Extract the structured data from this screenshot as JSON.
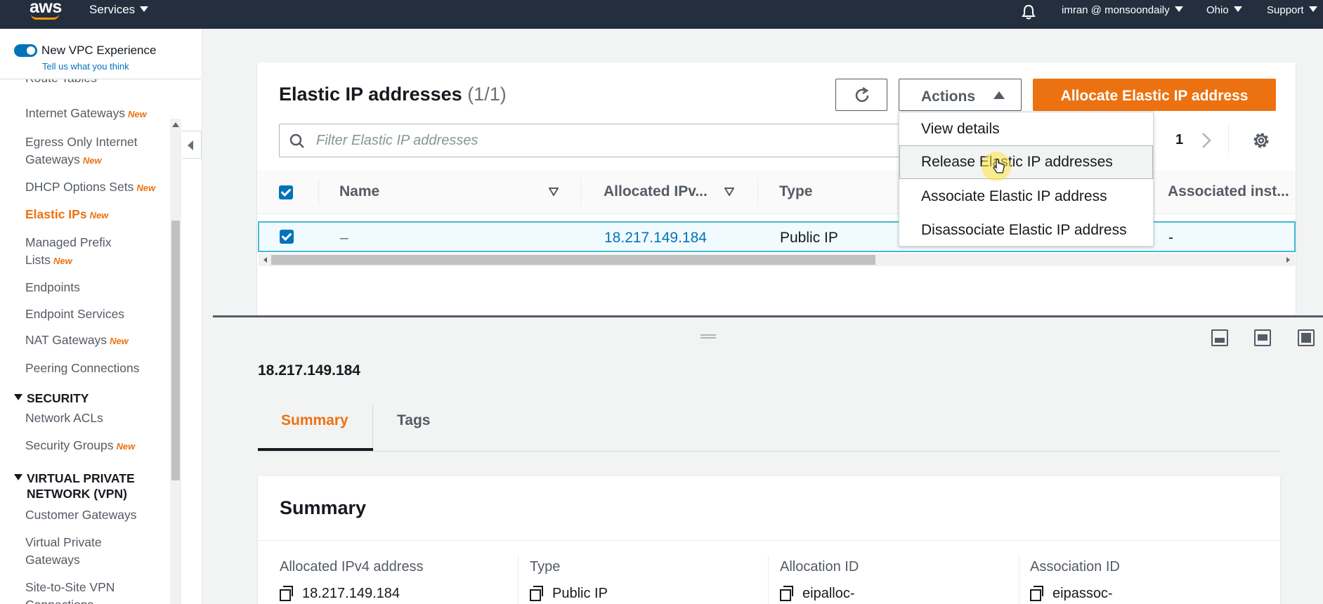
{
  "topnav": {
    "logo": "aws",
    "services": "Services",
    "account": "imran @ monsoondaily",
    "region": "Ohio",
    "support": "Support",
    "bell_icon": "bell-icon"
  },
  "sidebar": {
    "vpc_experience": "New VPC Experience",
    "feedback": "Tell us what you think",
    "partial_top": "Route Tables",
    "new_badge": "New",
    "items": [
      {
        "label": "Internet Gateways",
        "new": true
      },
      {
        "label": "Egress Only Internet Gateways",
        "new": true
      },
      {
        "label": "DHCP Options Sets",
        "new": true
      },
      {
        "label": "Elastic IPs",
        "new": true,
        "active": true
      },
      {
        "label": "Managed Prefix Lists",
        "new": true
      },
      {
        "label": "Endpoints",
        "new": false
      },
      {
        "label": "Endpoint Services",
        "new": false
      },
      {
        "label": "NAT Gateways",
        "new": true
      },
      {
        "label": "Peering Connections",
        "new": false
      }
    ],
    "security_heading": "SECURITY",
    "security_items": [
      {
        "label": "Network ACLs",
        "new": false
      },
      {
        "label": "Security Groups",
        "new": true
      }
    ],
    "vpn_heading": "VIRTUAL PRIVATE NETWORK (VPN)",
    "vpn_items": [
      {
        "label": "Customer Gateways",
        "new": false
      },
      {
        "label": "Virtual Private Gateways",
        "new": false
      },
      {
        "label": "Site-to-Site VPN Connections",
        "new": false
      }
    ]
  },
  "panel": {
    "title": "Elastic IP addresses",
    "count": "(1/1)",
    "actions_label": "Actions",
    "allocate_label": "Allocate Elastic IP address",
    "filter_placeholder": "Filter Elastic IP addresses",
    "page_number": "1",
    "columns": [
      "Name",
      "Allocated IPv...",
      "Type",
      "Associated inst..."
    ],
    "rows": [
      {
        "name": "–",
        "ip": "18.217.149.184",
        "type": "Public IP",
        "instance": "-",
        "selected": true
      }
    ]
  },
  "actions_menu": {
    "items": [
      "View details",
      "Release Elastic IP addresses",
      "Associate Elastic IP address",
      "Disassociate Elastic IP address"
    ],
    "hovered": "Release Elastic IP addresses"
  },
  "details": {
    "ip": "18.217.149.184",
    "tabs": [
      "Summary",
      "Tags"
    ],
    "active_tab": "Summary",
    "summary_title": "Summary",
    "fields": [
      {
        "label": "Allocated IPv4 address",
        "value": "18.217.149.184"
      },
      {
        "label": "Type",
        "value": "Public IP"
      },
      {
        "label": "Allocation ID",
        "value": "eipalloc-"
      },
      {
        "label": "Association ID",
        "value": "eipassoc-"
      }
    ]
  },
  "colors": {
    "nav_bg": "#232f3e",
    "accent_orange": "#ec7211",
    "link_blue": "#0073bb",
    "selected_row_border": "#44b9d6"
  }
}
